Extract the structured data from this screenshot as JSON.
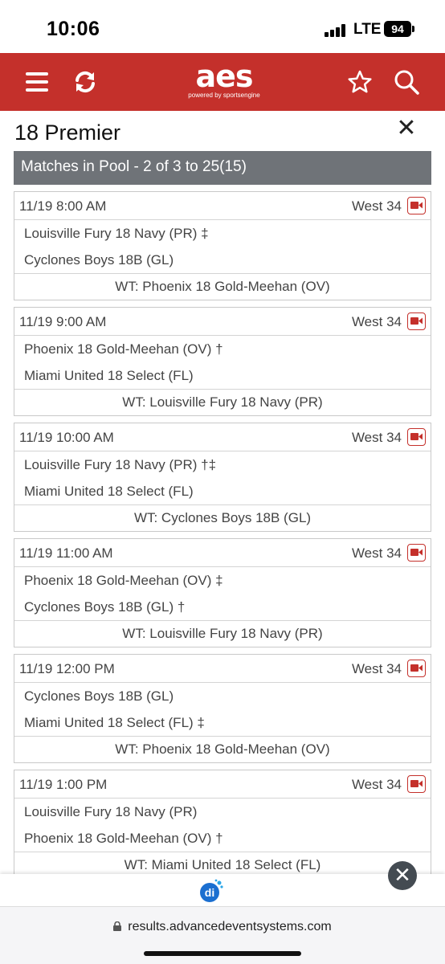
{
  "status_bar": {
    "time": "10:06",
    "network": "LTE",
    "battery": "94"
  },
  "header": {
    "logo": "aes",
    "logo_sub": "powered by sportsengine",
    "icons": [
      "menu-icon",
      "refresh-icon",
      "star-icon",
      "search-icon"
    ]
  },
  "page": {
    "title": "18 Premier",
    "close": "✕",
    "pool_bar": "Matches in Pool - 2 of 3 to 25(15)"
  },
  "matches": [
    {
      "time": "11/19 8:00 AM",
      "court": "West 34",
      "team1": "Louisville Fury 18 Navy (PR) ‡",
      "team2": "Cyclones Boys 18B (GL)",
      "wt": "WT: Phoenix 18 Gold-Meehan (OV)"
    },
    {
      "time": "11/19 9:00 AM",
      "court": "West 34",
      "team1": "Phoenix 18 Gold-Meehan (OV) †",
      "team2": "Miami United 18 Select (FL)",
      "wt": "WT: Louisville Fury 18 Navy (PR)"
    },
    {
      "time": "11/19 10:00 AM",
      "court": "West 34",
      "team1": "Louisville Fury 18 Navy (PR) †‡",
      "team2": "Miami United 18 Select (FL)",
      "wt": "WT: Cyclones Boys 18B (GL)"
    },
    {
      "time": "11/19 11:00 AM",
      "court": "West 34",
      "team1": "Phoenix 18 Gold-Meehan (OV) ‡",
      "team2": "Cyclones Boys 18B (GL) †",
      "wt": "WT: Louisville Fury 18 Navy (PR)"
    },
    {
      "time": "11/19 12:00 PM",
      "court": "West 34",
      "team1": "Cyclones Boys 18B (GL)",
      "team2": "Miami United 18 Select (FL) ‡",
      "wt": "WT: Phoenix 18 Gold-Meehan (OV)"
    },
    {
      "time": "11/19 1:00 PM",
      "court": "West 34",
      "team1": "Louisville Fury 18 Navy (PR)",
      "team2": "Phoenix 18 Gold-Meehan (OV) †",
      "wt": "WT: Miami United 18 Select (FL)"
    }
  ],
  "bottom": {
    "close_ad": "✕",
    "url": "results.advancedeventsystems.com"
  },
  "colors": {
    "brand_red": "#c4302b",
    "pool_bar": "#6f7378"
  }
}
